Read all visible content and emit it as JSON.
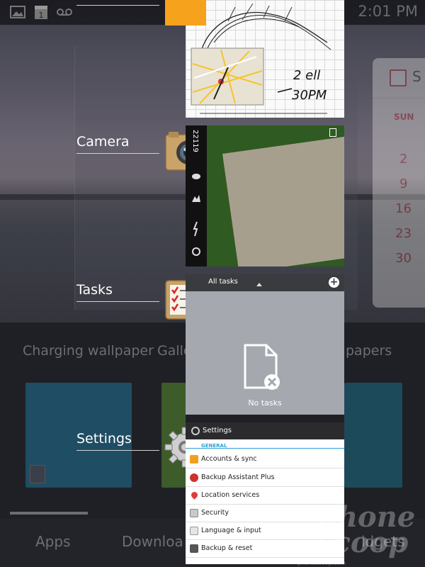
{
  "status_bar": {
    "time": "2:01 PM",
    "icons": [
      "image-icon",
      "calendar-date-icon",
      "voicemail-icon"
    ]
  },
  "home": {
    "wallpaper_labels": [
      "Charging wallpaper",
      "Galle",
      "papers"
    ],
    "bottom_tabs": [
      "Apps",
      "Downloa",
      "idgets"
    ]
  },
  "calendar_widget": {
    "title_letter": "S",
    "day_header": "SUN",
    "dates": [
      "2",
      "9",
      "16",
      "23",
      "30"
    ]
  },
  "recent_apps": [
    {
      "label": "",
      "icon": "notes-app-icon",
      "color": "#f7a21c"
    },
    {
      "label": "Camera",
      "icon": "camera-app-icon"
    },
    {
      "label": "Tasks",
      "icon": "tasks-app-icon"
    },
    {
      "label": "Settings",
      "icon": "settings-gear-icon"
    }
  ],
  "camera_preview": {
    "counter": "22119"
  },
  "tasks_card": {
    "header": "All tasks",
    "empty_text": "No tasks"
  },
  "settings_card": {
    "header": "Settings",
    "section": "GENERAL",
    "items": [
      {
        "label": "Accounts & sync",
        "color": "#f0a020"
      },
      {
        "label": "Backup Assistant Plus",
        "color": "#d0312d"
      },
      {
        "label": "Location services",
        "color": "#e23b3b"
      },
      {
        "label": "Security",
        "color": "#c9c9c9"
      },
      {
        "label": "Language & input",
        "color": "#e5e5e5"
      },
      {
        "label": "Backup & reset",
        "color": "#555555"
      }
    ]
  },
  "watermark": {
    "line1": "phone",
    "line2": "scoop",
    "small": "phonescoop.com"
  }
}
